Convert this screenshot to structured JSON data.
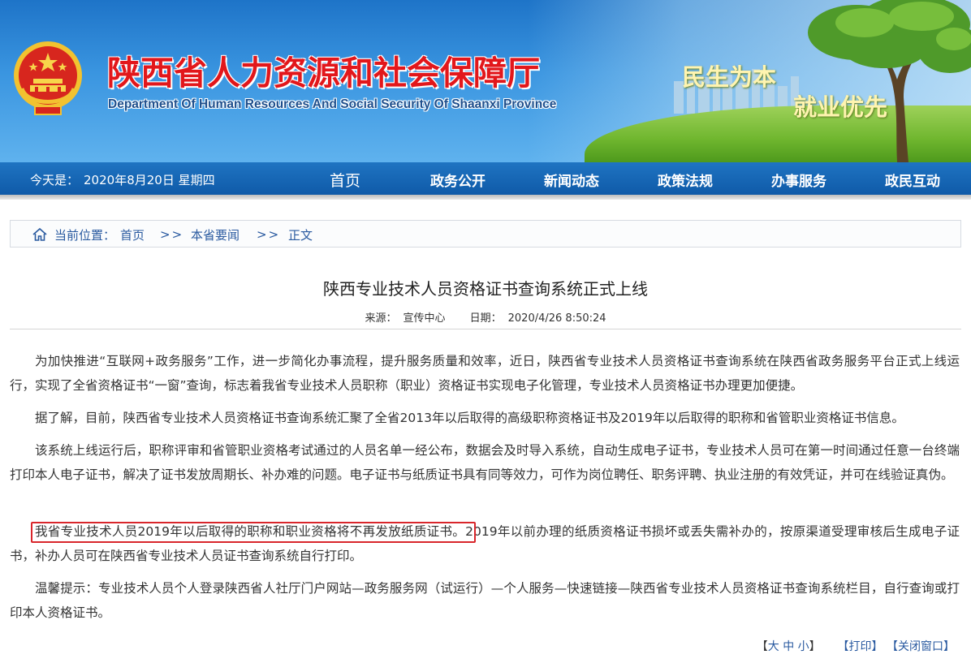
{
  "header": {
    "title": "陕西省人力资源和社会保障厅",
    "subtitle": "Department Of Human Resources And Social Security Of Shaanxi Province",
    "slogan_1": "民生为本",
    "slogan_2": "就业优先"
  },
  "nav": {
    "today_label": "今天是：",
    "today_value": "2020年8月20日 星期四",
    "items": [
      {
        "label": "首页"
      },
      {
        "label": "政务公开"
      },
      {
        "label": "新闻动态"
      },
      {
        "label": "政策法规"
      },
      {
        "label": "办事服务"
      },
      {
        "label": "政民互动"
      }
    ]
  },
  "breadcrumb": {
    "prefix": "当前位置：",
    "items": [
      "首页",
      "本省要闻",
      "正文"
    ],
    "separator": ">>"
  },
  "article": {
    "title": "陕西专业技术人员资格证书查询系统正式上线",
    "source_label": "来源：",
    "source": "宣传中心",
    "date_label": "日期：",
    "date": "2020/4/26 8:50:24",
    "paragraphs": [
      "为加快推进“互联网+政务服务”工作，进一步简化办事流程，提升服务质量和效率，近日，陕西省专业技术人员资格证书查询系统在陕西省政务服务平台正式上线运行，实现了全省资格证书“一窗”查询，标志着我省专业技术人员职称（职业）资格证书实现电子化管理，专业技术人员资格证书办理更加便捷。",
      "据了解，目前，陕西省专业技术人员资格证书查询系统汇聚了全省2013年以后取得的高级职称资格证书及2019年以后取得的职称和省管职业资格证书信息。",
      "该系统上线运行后，职称评审和省管职业资格考试通过的人员名单一经公布，数据会及时导入系统，自动生成电子证书，专业技术人员可在第一时间通过任意一台终端打印本人电子证书，解决了证书发放周期长、补办难的问题。电子证书与纸质证书具有同等效力，可作为岗位聘任、职务评聘、执业注册的有效凭证，并可在线验证真伪。",
      "温馨提示：专业技术人员个人登录陕西省人社厅门户网站—政务服务网（试运行）—个人服务—快速链接—陕西省专业技术人员资格证书查询系统栏目，自行查询或打印本人资格证书。"
    ],
    "p4_highlight": "我省专业技术人员2019年以后取得的职称和职业资格将不再发放纸质证书。",
    "p4_rest": "2019年以前办理的纸质资格证书损坏或丢失需补办的，按原渠道受理审核后生成电子证书，补办人员可在陕西省专业技术人员证书查询系统自行打印。"
  },
  "tools": {
    "size_open": "【",
    "size_large": "大",
    "size_medium": "中",
    "size_small": "小",
    "size_close": "】",
    "print": "【打印】",
    "close_window": "【关闭窗口】"
  },
  "colors": {
    "title_red": "#e2171b",
    "nav_blue": "#0f5aa8",
    "link_blue": "#2a5aa0",
    "highlight_box": "#d9262b"
  }
}
